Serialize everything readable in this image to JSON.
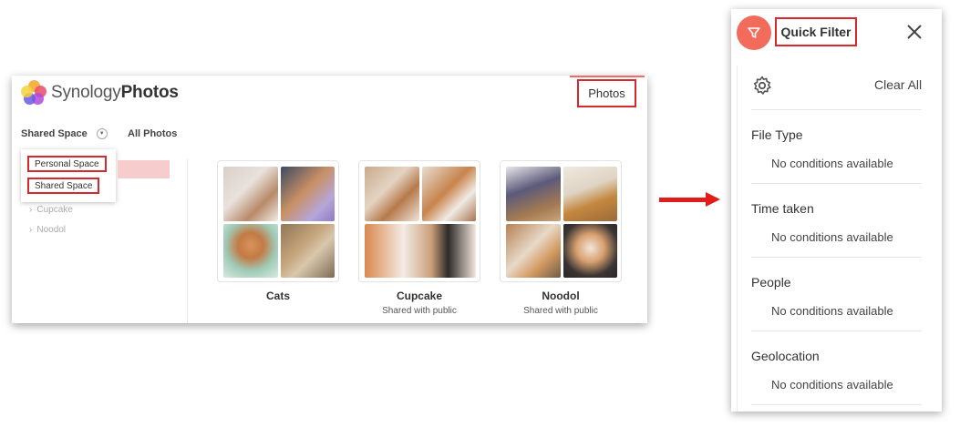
{
  "app": {
    "brand_light": "Synology",
    "brand_bold": "Photos",
    "photos_button": "Photos",
    "space_selector": "Shared Space",
    "all_photos": "All Photos",
    "dropdown_items": [
      "Personal Space",
      "Shared Space"
    ],
    "tree_items": [
      "Cupcake",
      "Noodol"
    ],
    "albums": [
      {
        "title": "Cats",
        "subtitle": ""
      },
      {
        "title": "Cupcake",
        "subtitle": "Shared with public"
      },
      {
        "title": "Noodol",
        "subtitle": "Shared with public"
      }
    ]
  },
  "quick_filter": {
    "title": "Quick Filter",
    "clear_all": "Clear All",
    "sections": [
      {
        "title": "File Type",
        "empty": "No conditions available"
      },
      {
        "title": "Time taken",
        "empty": "No conditions available"
      },
      {
        "title": "People",
        "empty": "No conditions available"
      },
      {
        "title": "Geolocation",
        "empty": "No conditions available"
      }
    ]
  },
  "icons": [
    "synology-photos-logo-icon",
    "chevron-down-icon",
    "chevron-right-icon",
    "filter-icon",
    "close-icon",
    "gear-icon",
    "arrow-right-icon"
  ],
  "colors": {
    "highlight_border": "#d9272e",
    "filter_accent": "#f26b5b",
    "arrow": "#e21b1b",
    "selected_pink": "#f7cccc"
  }
}
